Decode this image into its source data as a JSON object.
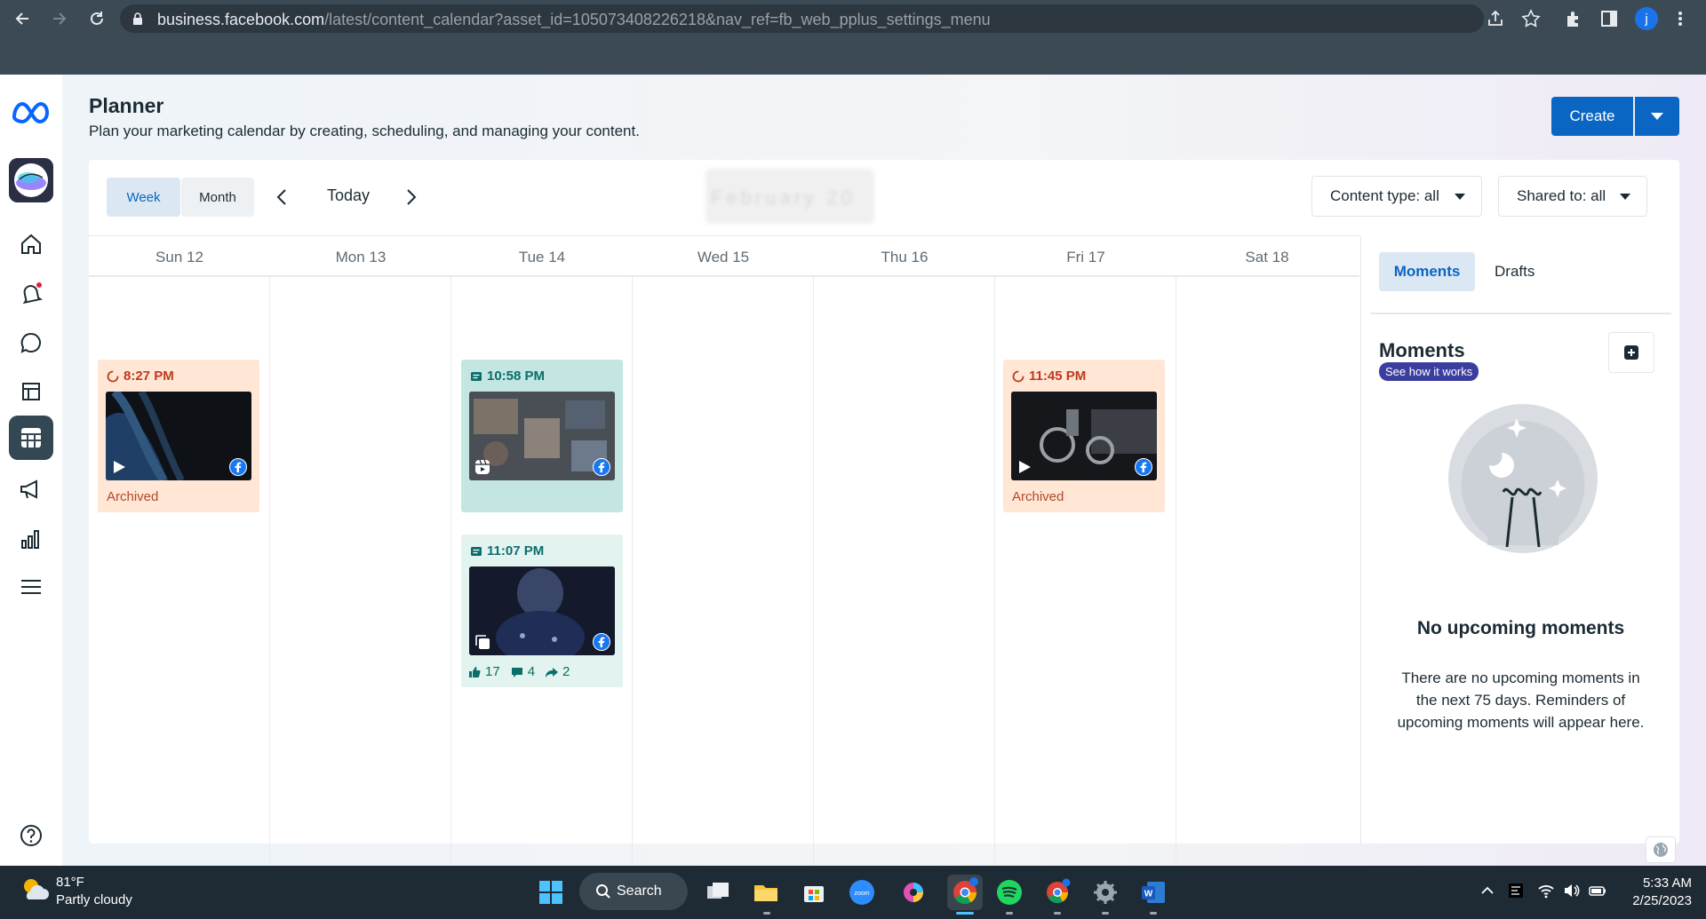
{
  "browser": {
    "url_main": "business.facebook.com",
    "url_rest": "/latest/content_calendar?asset_id=105073408226218&nav_ref=fb_web_pplus_settings_menu",
    "profile_initial": "j"
  },
  "header": {
    "title": "Planner",
    "subtitle": "Plan your marketing calendar by creating, scheduling, and managing your content.",
    "create_label": "Create"
  },
  "toolbar": {
    "week_label": "Week",
    "month_label": "Month",
    "today_label": "Today",
    "date_range_blurred": "February 20",
    "content_type_filter": "Content type: all",
    "shared_to_filter": "Shared to: all"
  },
  "days": [
    "Sun 12",
    "Mon 13",
    "Tue 14",
    "Wed 15",
    "Thu 16",
    "Fri 17",
    "Sat 18"
  ],
  "posts": [
    {
      "day": "Sun 12",
      "time": "8:27 PM",
      "status": "Archived",
      "kind": "archived",
      "media": "video"
    },
    {
      "day": "Tue 14",
      "time": "10:58 PM",
      "status": "",
      "kind": "scheduled",
      "media": "reel"
    },
    {
      "day": "Tue 14",
      "time": "11:07 PM",
      "status": "",
      "kind": "published",
      "media": "carousel",
      "likes": "17",
      "comments": "4",
      "shares": "2"
    },
    {
      "day": "Fri 17",
      "time": "11:45 PM",
      "status": "Archived",
      "kind": "archived",
      "media": "video"
    }
  ],
  "side_panel": {
    "tab_moments": "Moments",
    "tab_drafts": "Drafts",
    "heading": "Moments",
    "see_how": "See how it works",
    "empty_title": "No upcoming moments",
    "empty_text": "There are no upcoming moments in the next 75 days. Reminders of upcoming moments will appear here."
  },
  "taskbar": {
    "temperature": "81°F",
    "weather": "Partly cloudy",
    "search_label": "Search",
    "time": "5:33 AM",
    "date": "2/25/2023"
  },
  "colors": {
    "brand_blue": "#0a66c2",
    "archived_bg": "#ffe6d5",
    "scheduled_bg": "#c3e6e2",
    "published_bg": "#e3f3ef"
  }
}
